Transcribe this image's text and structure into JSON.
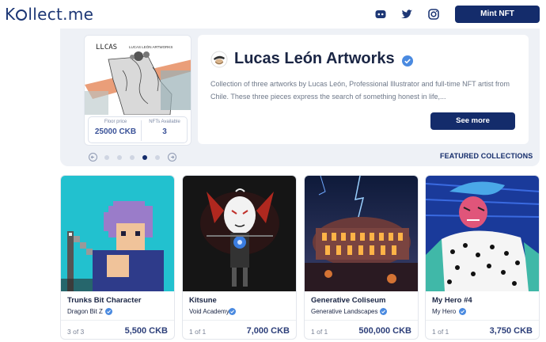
{
  "header": {
    "logo_text_pre": "K",
    "logo_text_post": "llect.me",
    "mint_label": "Mint NFT",
    "icons": [
      "discord-icon",
      "twitter-icon",
      "instagram-icon"
    ]
  },
  "featured": {
    "art_brand": "LUCAS LEÓN ARTWORKS",
    "art_logo": "LLCAS",
    "floor_label": "Floor price",
    "floor_value": "25000 CKB",
    "available_label": "NFTs Available",
    "available_value": "3",
    "artist_name": "Lucas León Artworks",
    "description": "Collection of three artworks by Lucas León, Professional Illustrator and full-time NFT artist from Chile. These three pieces express the search of something honest in life,...",
    "see_more_label": "See more",
    "featured_link": "FEATURED COLLECTIONS",
    "carousel_active_index": 4,
    "carousel_count": 6
  },
  "nfts": [
    {
      "title": "Trunks Bit Character",
      "collection": "Dragon Bit Z",
      "edition": "3 of 3",
      "price": "5,500 CKB"
    },
    {
      "title": "Kitsune",
      "collection": "Void Academy",
      "edition": "1 of 1",
      "price": "7,000 CKB"
    },
    {
      "title": "Generative Coliseum",
      "collection": "Generative Landscapes",
      "edition": "1 of 1",
      "price": "500,000 CKB"
    },
    {
      "title": "My Hero #4",
      "collection": "My Hero",
      "edition": "1 of 1",
      "price": "3,750 CKB"
    }
  ],
  "colors": {
    "brand": "#142c6b",
    "verified": "#4a8ae0",
    "bg_featured": "#eef1f6"
  }
}
